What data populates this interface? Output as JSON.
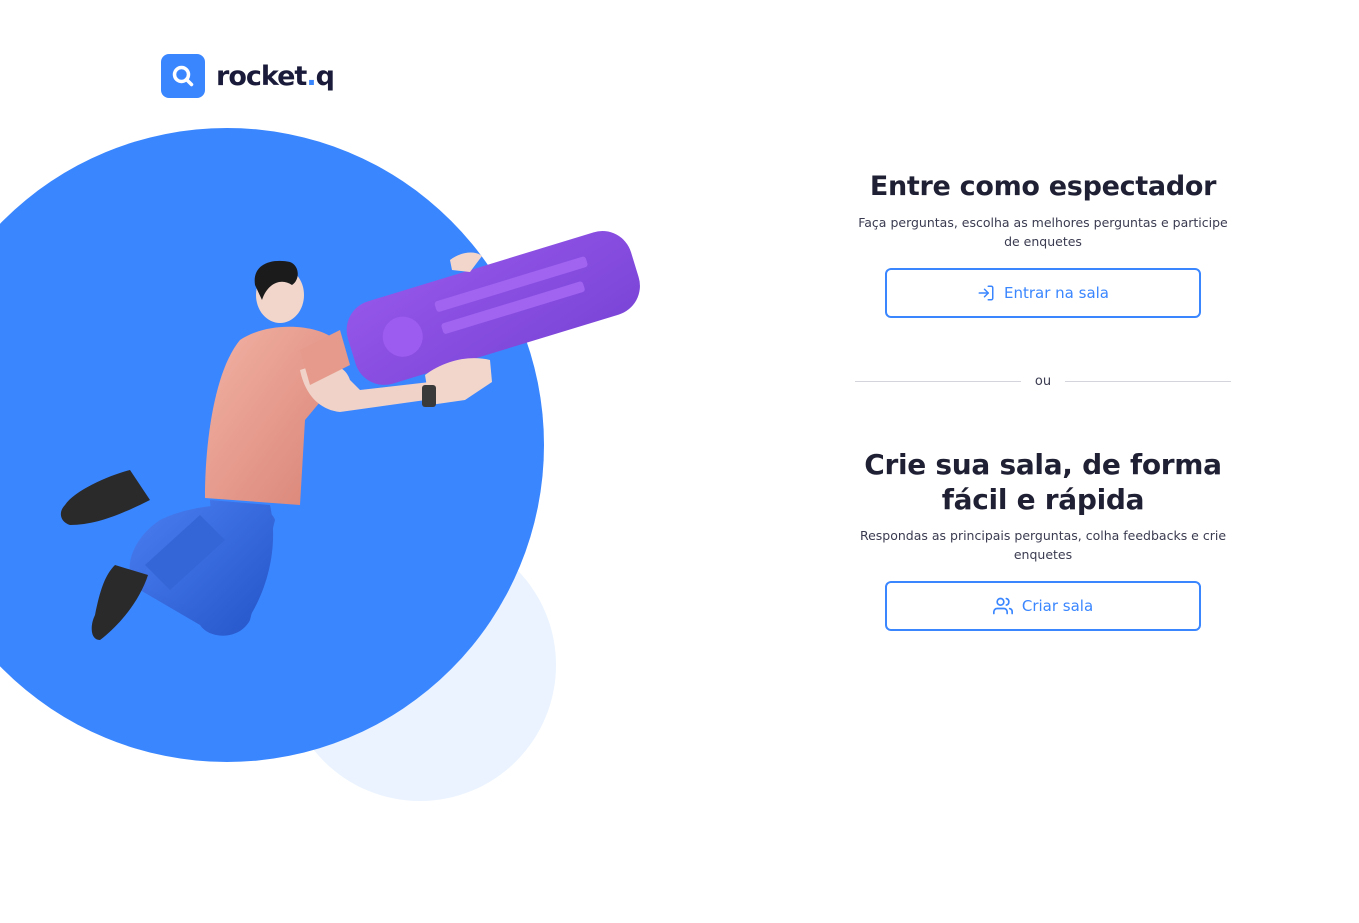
{
  "brand": {
    "name_main": "rocket",
    "name_dot": ".",
    "name_tail": "q",
    "accent_color": "#3a86ff",
    "logo_icon": "search-magnifier-icon"
  },
  "illustration": {
    "description_icon": "person-holding-chat-bubble-illustration",
    "colors": {
      "big_circle": "#3a86ff",
      "small_circle": "#eaf3ff",
      "bubble": "#8a4fe0"
    }
  },
  "viewer": {
    "title": "Entre como espectador",
    "description": "Faça perguntas, escolha as melhores perguntas e participe de enquetes",
    "button_label": "Entrar na sala",
    "button_icon": "log-in-icon"
  },
  "divider": {
    "label": "ou"
  },
  "creator": {
    "title": "Crie sua sala, de forma fácil e rápida",
    "description": "Respondas as principais perguntas, colha feedbacks e crie enquetes",
    "button_label": "Criar sala",
    "button_icon": "users-icon"
  }
}
